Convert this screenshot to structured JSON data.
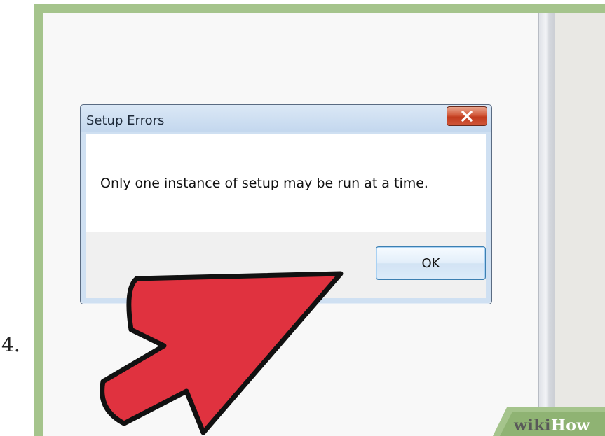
{
  "step": {
    "number": "4."
  },
  "dialog": {
    "title": "Setup Errors",
    "message": "Only one instance of setup may be run at a time.",
    "ok_label": "OK"
  },
  "icons": {
    "close": "close-icon",
    "pointer": "red-arrow-icon"
  },
  "watermark": {
    "wiki": "wiki",
    "how": "How"
  },
  "colors": {
    "frame": "#a5c48c",
    "arrow": "#e0323f",
    "close_button": "#c94a2c",
    "titlebar": "#c3d7ee",
    "ok_border": "#3c7fb1"
  }
}
